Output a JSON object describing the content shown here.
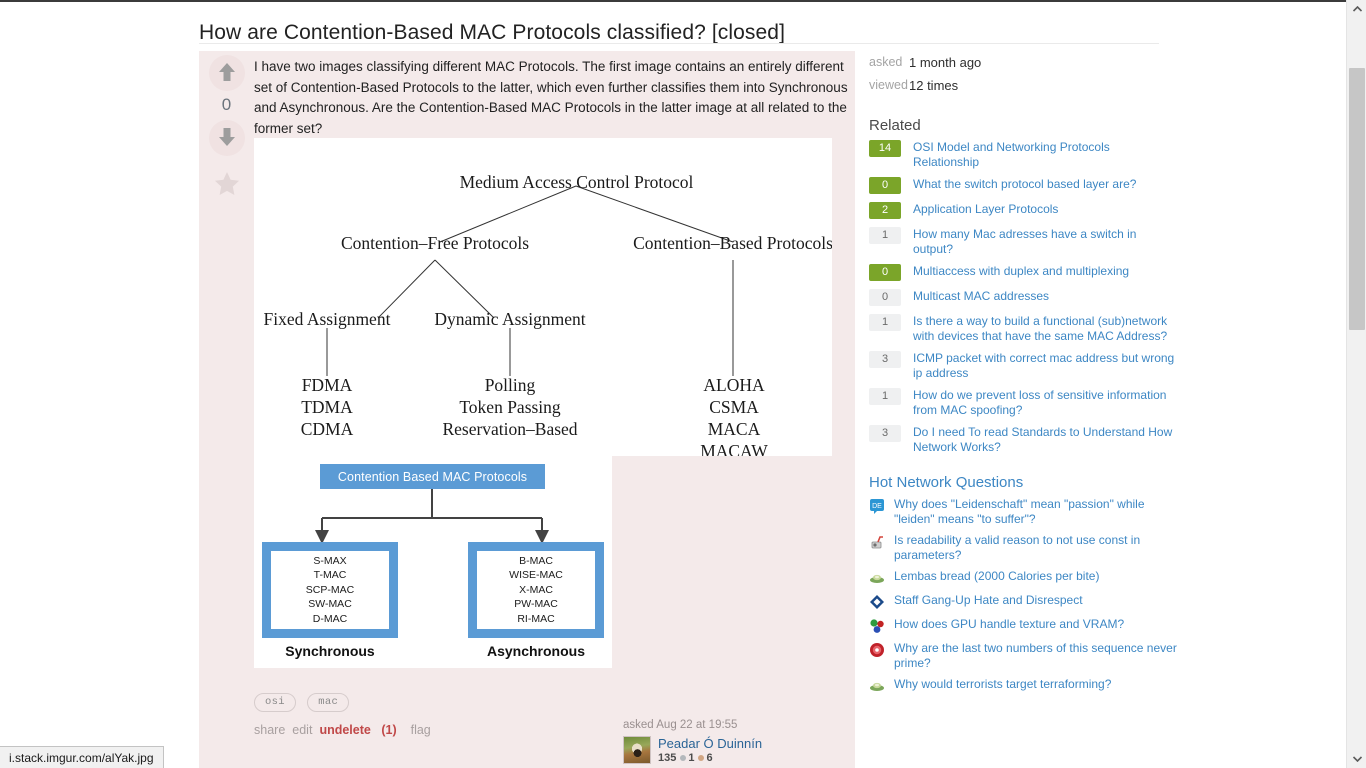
{
  "question": {
    "title": "How are Contention-Based MAC Protocols classified? [closed]",
    "body": "I have two images classifying different MAC Protocols. The first image contains an entirely different set of Contention-Based Protocols to the latter, which even further classifies them into Synchronous and Asynchronous. Are the Contention-Based MAC Protocols in the latter image at all related to the former set?",
    "vote_count": "0",
    "upvote_icon": "arrow-up-icon",
    "downvote_icon": "arrow-down-icon",
    "favorite_icon": "star-icon"
  },
  "figure1": {
    "root": "Medium Access Control Protocol",
    "level2": [
      "Contention–Free Protocols",
      "Contention–Based Protocols"
    ],
    "level3": [
      "Fixed Assignment",
      "Dynamic Assignment"
    ],
    "leaves_fixed": [
      "FDMA",
      "TDMA",
      "CDMA"
    ],
    "leaves_dynamic": [
      "Polling",
      "Token Passing",
      "Reservation–Based"
    ],
    "leaves_contention": [
      "ALOHA",
      "CSMA",
      "MACA",
      "MACAW"
    ]
  },
  "figure2": {
    "header": "Contention Based MAC Protocols",
    "left_caption": "Synchronous",
    "right_caption": "Asynchronous",
    "left_items": [
      "S-MAX",
      "T-MAC",
      "SCP-MAC",
      "SW-MAC",
      "D-MAC"
    ],
    "right_items": [
      "B-MAC",
      "WISE-MAC",
      "X-MAC",
      "PW-MAC",
      "RI-MAC"
    ],
    "accent_color": "#5b9bd5"
  },
  "tags": [
    "osi",
    "mac"
  ],
  "postmenu": {
    "share": "share",
    "edit": "edit",
    "undelete": "undelete",
    "undelete_count": "(1)",
    "flag": "flag"
  },
  "usercard": {
    "when": "asked Aug 22 at 19:55",
    "name": "Peadar Ó Duinnín",
    "reputation": "135",
    "silver_badges": "1",
    "bronze_badges": "6"
  },
  "stats": [
    {
      "key": "asked",
      "value": "1 month ago"
    },
    {
      "key": "viewed",
      "value": "12 times"
    }
  ],
  "related": {
    "heading": "Related",
    "items": [
      {
        "score": "14",
        "answered": true,
        "title": "OSI Model and Networking Protocols Relationship"
      },
      {
        "score": "0",
        "answered": true,
        "title": "What the switch protocol based layer are?"
      },
      {
        "score": "2",
        "answered": true,
        "title": "Application Layer Protocols"
      },
      {
        "score": "1",
        "answered": false,
        "title": "How many Mac adresses have a switch in output?"
      },
      {
        "score": "0",
        "answered": true,
        "title": "Multiaccess with duplex and multiplexing"
      },
      {
        "score": "0",
        "answered": false,
        "title": "Multicast MAC addresses"
      },
      {
        "score": "1",
        "answered": false,
        "title": "Is there a way to build a functional (sub)network with devices that have the same MAC Address?"
      },
      {
        "score": "3",
        "answered": false,
        "title": "ICMP packet with correct mac address but wrong ip address"
      },
      {
        "score": "1",
        "answered": false,
        "title": "How do we prevent loss of sensitive information from MAC spoofing?"
      },
      {
        "score": "3",
        "answered": false,
        "title": "Do I need To read Standards to Understand How Network Works?"
      }
    ]
  },
  "hot": {
    "heading": "Hot Network Questions",
    "items": [
      {
        "icon": "german-se-icon",
        "title": "Why does \"Leidenschaft\" mean \"passion\" while \"leiden\" means \"to suffer\"?"
      },
      {
        "icon": "software-engineering-icon",
        "title": "Is readability a valid reason to not use const in parameters?"
      },
      {
        "icon": "scifi-icon",
        "title": "Lembas bread (2000 Calories per bite)"
      },
      {
        "icon": "workplace-icon",
        "title": "Staff Gang-Up Hate and Disrespect"
      },
      {
        "icon": "computer-graphics-icon",
        "title": "How does GPU handle texture and VRAM?"
      },
      {
        "icon": "math-icon",
        "title": "Why are the last two numbers of this sequence never prime?"
      },
      {
        "icon": "scifi-icon",
        "title": "Why would terrorists target terraforming?"
      }
    ]
  },
  "statusbar": {
    "url": "i.stack.imgur.com/alYak.jpg"
  },
  "colors": {
    "deleted_post_background": "#f4eaea",
    "link": "#3d87c4",
    "badge_green": "#7ba529",
    "undelete_red": "#c04848"
  }
}
